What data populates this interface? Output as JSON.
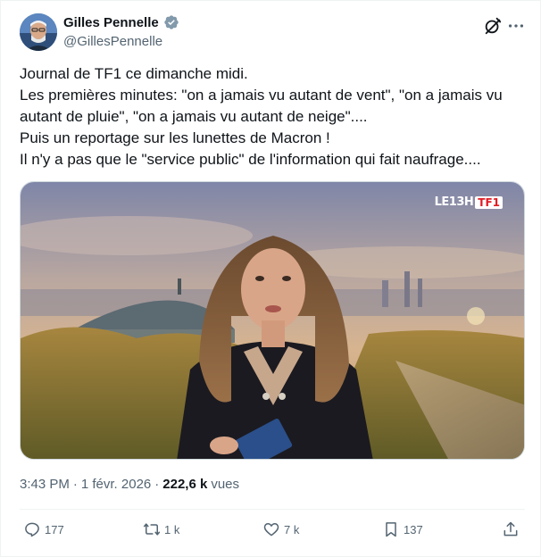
{
  "author": {
    "display_name": "Gilles Pennelle",
    "handle": "@GillesPennelle",
    "verified": true
  },
  "tweet": {
    "lines": [
      "Journal de TF1 ce dimanche midi.",
      "Les premières minutes: \"on a jamais vu autant de vent\", \"on a jamais vu",
      "autant de pluie\", \"on a jamais vu autant de neige\"....",
      "Puis un reportage sur les lunettes de Macron !",
      "Il n'y a pas que le \"service public\" de l'information qui fait naufrage...."
    ],
    "media": {
      "show_logo": "LE13H",
      "channel_logo": "TF1"
    }
  },
  "meta": {
    "time": "3:43 PM",
    "separator": "·",
    "date": "1 févr. 2026",
    "views_count": "222,6 k",
    "views_label": "vues"
  },
  "actions": {
    "replies": "177",
    "reposts": "1 k",
    "likes": "7 k",
    "bookmarks": "137"
  },
  "colors": {
    "text": "#0f1419",
    "secondary": "#536471",
    "verified_badge": "#829aab",
    "tf1_red": "#e21a22"
  }
}
